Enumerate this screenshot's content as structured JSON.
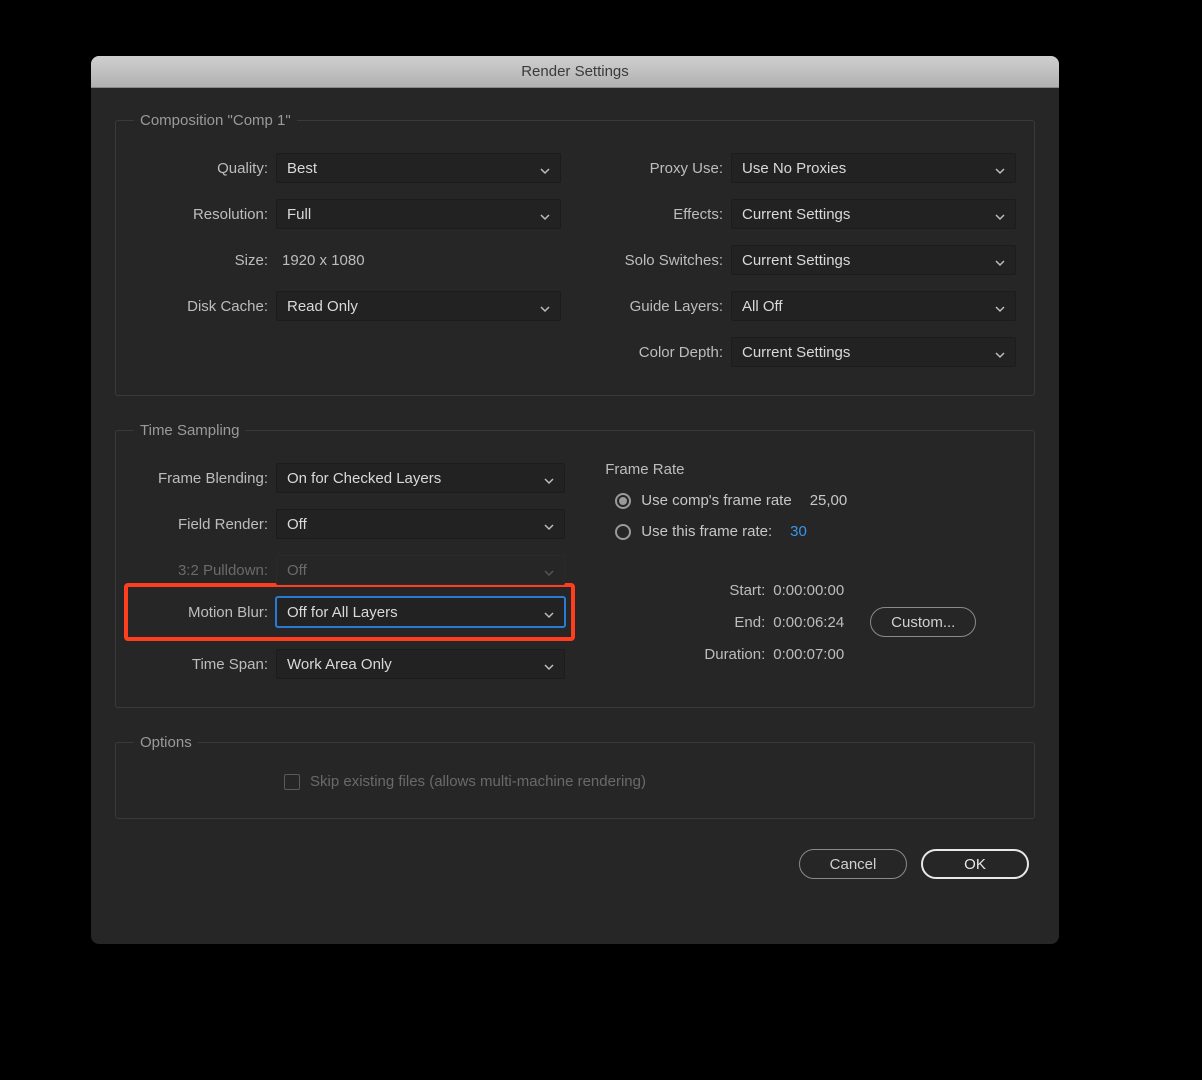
{
  "dialog": {
    "title": "Render Settings"
  },
  "composition": {
    "legend": "Composition \"Comp 1\"",
    "quality": {
      "label": "Quality:",
      "value": "Best"
    },
    "resolution": {
      "label": "Resolution:",
      "value": "Full"
    },
    "size": {
      "label": "Size:",
      "value": "1920 x 1080"
    },
    "disk_cache": {
      "label": "Disk Cache:",
      "value": "Read Only"
    },
    "proxy_use": {
      "label": "Proxy Use:",
      "value": "Use No Proxies"
    },
    "effects": {
      "label": "Effects:",
      "value": "Current Settings"
    },
    "solo": {
      "label": "Solo Switches:",
      "value": "Current Settings"
    },
    "guide": {
      "label": "Guide Layers:",
      "value": "All Off"
    },
    "color_depth": {
      "label": "Color Depth:",
      "value": "Current Settings"
    }
  },
  "time_sampling": {
    "legend": "Time Sampling",
    "frame_blending": {
      "label": "Frame Blending:",
      "value": "On for Checked Layers"
    },
    "field_render": {
      "label": "Field Render:",
      "value": "Off"
    },
    "pulldown": {
      "label": "3:2 Pulldown:",
      "value": "Off"
    },
    "motion_blur": {
      "label": "Motion Blur:",
      "value": "Off for All Layers"
    },
    "time_span": {
      "label": "Time Span:",
      "value": "Work Area Only"
    },
    "frame_rate": {
      "title": "Frame Rate",
      "comp": {
        "label": "Use comp's frame rate",
        "value": "25,00"
      },
      "custom": {
        "label": "Use this frame rate:",
        "value": "30"
      }
    },
    "times": {
      "start": {
        "label": "Start:",
        "value": "0:00:00:00"
      },
      "end": {
        "label": "End:",
        "value": "0:00:06:24"
      },
      "duration": {
        "label": "Duration:",
        "value": "0:00:07:00"
      },
      "custom_btn": "Custom..."
    }
  },
  "options": {
    "legend": "Options",
    "skip_files": "Skip existing files (allows multi-machine rendering)"
  },
  "footer": {
    "cancel": "Cancel",
    "ok": "OK"
  }
}
